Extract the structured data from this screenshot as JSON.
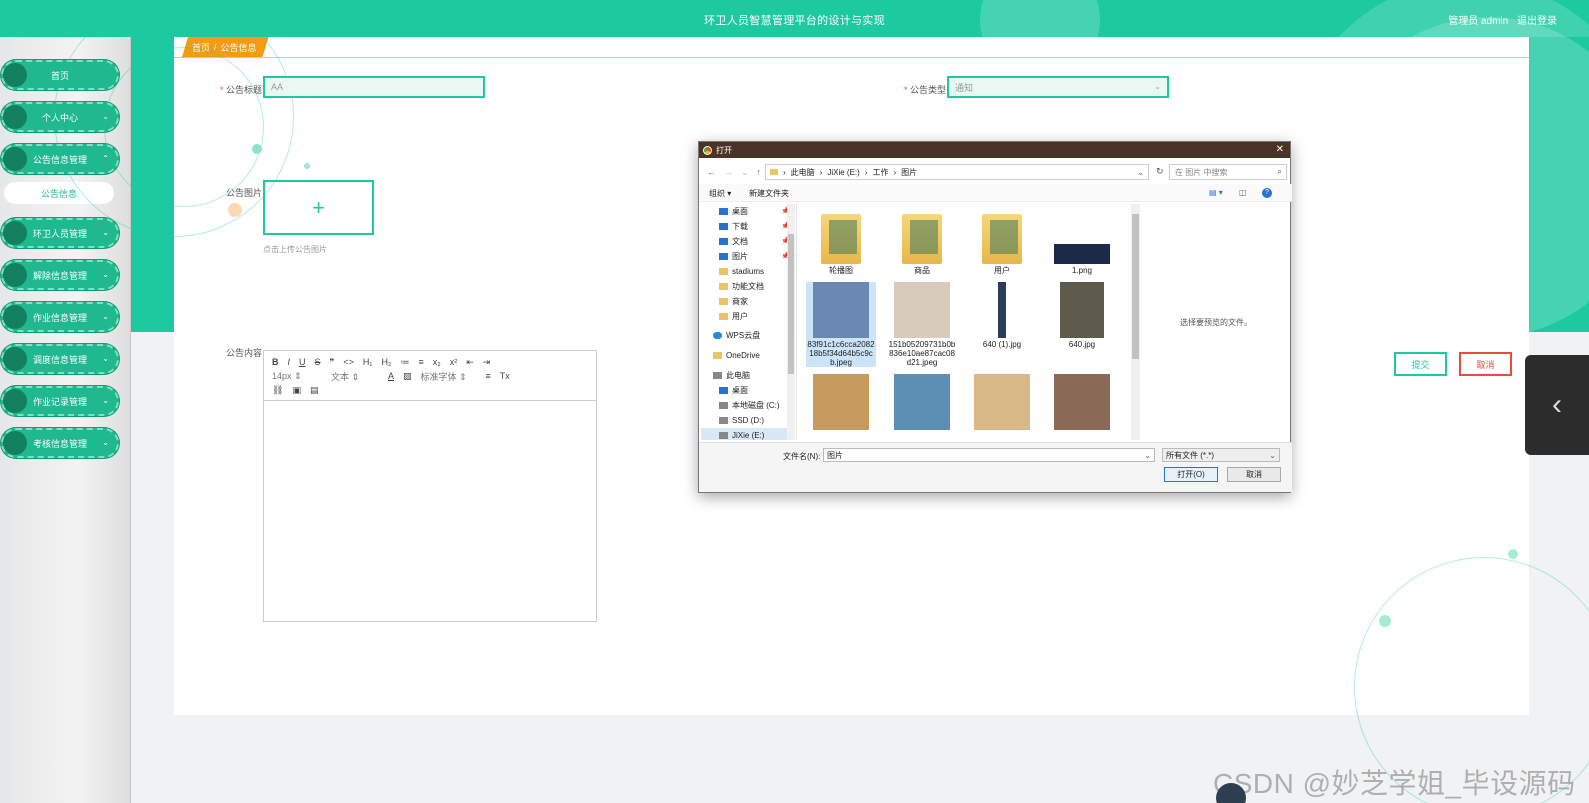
{
  "header": {
    "title": "环卫人员智慧管理平台的设计与实现",
    "user_label": "管理员 admin",
    "logout": "退出登录"
  },
  "sidebar": {
    "items": [
      {
        "label": "首页"
      },
      {
        "label": "个人中心"
      },
      {
        "label": "公告信息管理"
      },
      {
        "label": "环卫人员管理"
      },
      {
        "label": "解除信息管理"
      },
      {
        "label": "作业信息管理"
      },
      {
        "label": "调度信息管理"
      },
      {
        "label": "作业记录管理"
      },
      {
        "label": "考核信息管理"
      }
    ],
    "submenu": {
      "label": "公告信息"
    }
  },
  "breadcrumb": {
    "home": "首页",
    "separator": "/",
    "current": "公告信息"
  },
  "form": {
    "title_label": "公告标题",
    "title_value": "AA",
    "type_label": "公告类型",
    "type_value": "通知",
    "image_label": "公告图片",
    "upload_plus": "+",
    "upload_hint": "点击上传公告图片",
    "content_label": "公告内容",
    "required_mark": "*",
    "submit": "提交",
    "cancel": "取消"
  },
  "editor": {
    "row1": [
      "B",
      "I",
      "U",
      "S",
      "❞",
      "<>",
      "H₁",
      "H₂",
      "≔",
      "≡",
      "x₂",
      "x²",
      "⇤",
      "⇥"
    ],
    "font_size": "14px",
    "text_style": "文本",
    "font_family": "标准字体",
    "row2_icons": [
      "A",
      "▨",
      "≡",
      "Tx"
    ],
    "row3": [
      "⛓",
      "▣",
      "▤"
    ]
  },
  "side_tab": {
    "glyph": "‹"
  },
  "dialog": {
    "title": "打开",
    "close": "✕",
    "path": [
      "此电脑",
      "JiXie (E:)",
      "工作",
      "图片"
    ],
    "path_sep": "›",
    "search_placeholder": "在 图片 中搜索",
    "organize": "组织 ▾",
    "new_folder": "新建文件夹",
    "help": "?",
    "nav": [
      {
        "label": "桌面",
        "icon": "blue",
        "pin": true
      },
      {
        "label": "下载",
        "icon": "blue",
        "pin": true
      },
      {
        "label": "文档",
        "icon": "blue",
        "pin": true
      },
      {
        "label": "图片",
        "icon": "blue",
        "pin": true
      },
      {
        "label": "stadiums",
        "icon": "folder",
        "pin": false
      },
      {
        "label": "功能文档",
        "icon": "folder",
        "pin": false
      },
      {
        "label": "商家",
        "icon": "folder",
        "pin": false
      },
      {
        "label": "用户",
        "icon": "folder",
        "pin": false
      },
      {
        "label": "WPS云盘",
        "icon": "cloud",
        "pin": false
      },
      {
        "label": "OneDrive",
        "icon": "folder",
        "pin": false
      },
      {
        "label": "此电脑",
        "icon": "drive",
        "pin": false
      },
      {
        "label": "桌面",
        "icon": "blue",
        "pin": false
      },
      {
        "label": "本地磁盘 (C:)",
        "icon": "drive",
        "pin": false
      },
      {
        "label": "SSD (D:)",
        "icon": "drive",
        "pin": false
      },
      {
        "label": "JiXie (E:)",
        "icon": "drive",
        "pin": false
      }
    ],
    "files": [
      {
        "name": "轮播图",
        "kind": "folder",
        "color": "#e8b64a"
      },
      {
        "name": "商品",
        "kind": "folder",
        "color": "#e8b64a"
      },
      {
        "name": "用户",
        "kind": "folder",
        "color": "#e8b64a"
      },
      {
        "name": "1.png",
        "kind": "image",
        "color": "#1c2a4a"
      },
      {
        "name": "83f91c1c6cca208218b5f34d64b5c9cb.jpeg",
        "kind": "image",
        "color": "#6a88b3"
      },
      {
        "name": "151b05209731b0b836e10ae87cac08d21.jpeg",
        "kind": "image",
        "color": "#d8cbbb"
      },
      {
        "name": "640 (1).jpg",
        "kind": "image",
        "color": "#2a3f55"
      },
      {
        "name": "640.jpg",
        "kind": "image",
        "color": "#5e5a4c"
      },
      {
        "name": "",
        "kind": "image",
        "color": "#c79a5e"
      },
      {
        "name": "",
        "kind": "image",
        "color": "#5d8eb3"
      },
      {
        "name": "",
        "kind": "image",
        "color": "#d7b887"
      },
      {
        "name": "",
        "kind": "image",
        "color": "#8a6a57"
      }
    ],
    "preview_text": "选择要预览的文件。",
    "filename_label": "文件名(N):",
    "filename_value": "图片",
    "filetype_value": "所有文件 (*.*)",
    "open_button": "打开(O)",
    "cancel_button": "取消"
  },
  "watermark": "CSDN @妙芝学姐_毕设源码",
  "colors": {
    "accent": "#1dcaa0",
    "danger": "#e74c3c",
    "breadcrumb": "#f39c12"
  }
}
